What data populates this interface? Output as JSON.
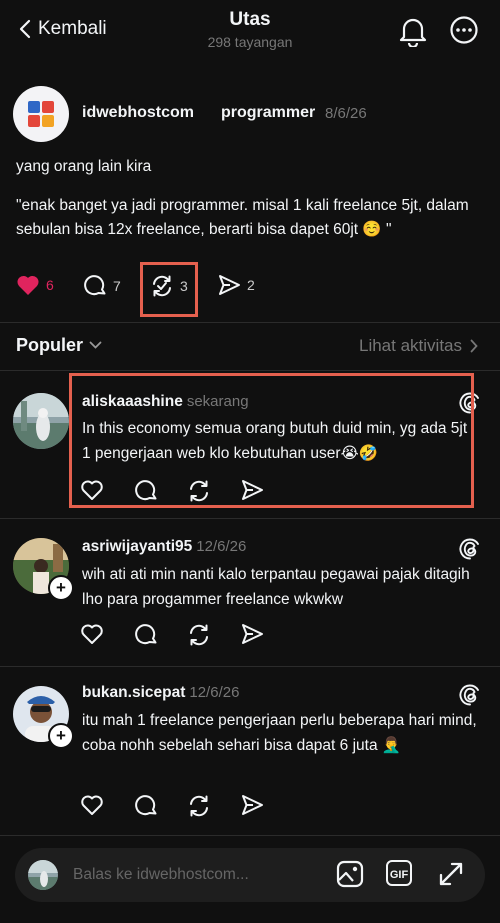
{
  "header": {
    "back_label": "Kembali",
    "title": "Utas",
    "views": "298 tayangan"
  },
  "post": {
    "username": "idwebhostcom",
    "tag": "programmer",
    "date": "8/6/26",
    "line1": "yang orang lain kira",
    "body": "\"enak banget ya jadi programmer. misal 1 kali freelance 5jt, dalam sebulan bisa 12x freelance, berarti bisa dapet 60jt ☺️ \"",
    "likes": "6",
    "replies": "7",
    "reposts": "3",
    "shares": "2",
    "accent": "#e0245e"
  },
  "section": {
    "sort_label": "Populer",
    "activity_label": "Lihat aktivitas"
  },
  "replies": [
    {
      "username": "aliskaaashine",
      "time": "sekarang",
      "text": "In this economy semua orang butuh duid min, yg ada 5jt 1 pengerjaan web klo kebutuhan user😭🤣"
    },
    {
      "username": "asriwijayanti95",
      "time": "12/6/26",
      "text": "wih ati ati min nanti kalo terpantau pegawai pajak ditagih lho para progammer freelance wkwkw"
    },
    {
      "username": "bukan.sicepat",
      "time": "12/6/26",
      "text": "itu mah 1 freelance pengerjaan perlu beberapa hari mind, coba nohh sebelah sehari bisa dapat 6 juta 🤦‍♂️"
    }
  ],
  "composer": {
    "placeholder": "Balas ke idwebhostcom...",
    "gif_label": "GIF"
  },
  "annotation_color": "#e4604e"
}
